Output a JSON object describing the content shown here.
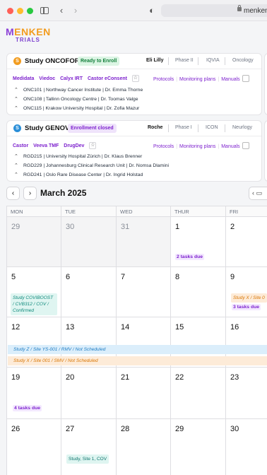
{
  "browser": {
    "url": "menkentr"
  },
  "logo": {
    "main_first": "M",
    "main_rest": "ENKEN",
    "sub": "TRIALS"
  },
  "studies": [
    {
      "initial": "S",
      "title": "Study ONCOFORM",
      "status": "Ready to Enroll",
      "sponsor": "Eli Lilly",
      "phase": "Phase II",
      "cro": "IQVIA",
      "area": "Oncology",
      "tools": [
        "Medidata",
        "Viedoc",
        "Calyx IRT",
        "Castor eConsent"
      ],
      "links": [
        "Protocols",
        "Monitoring plans",
        "Manuals"
      ],
      "sites": [
        "ONC101  |  Northway Cancer Institute  |  Dr. Emma Thorne",
        "ONC108  |  Tallinn Oncology Centre  |  Dr. Toomas Valge",
        "ONC115  |  Krakow University Hospital  |  Dr. Zofia Mazur"
      ]
    },
    {
      "initial": "S",
      "title": "Study GENOVA",
      "status": "Enrollment closed",
      "sponsor": "Roche",
      "phase": "Phase I",
      "cro": "ICON",
      "area": "Neurlogy",
      "tools": [
        "Castor",
        "Veeva TMF",
        "DrugDev"
      ],
      "links": [
        "Protocols",
        "Monitoring plans",
        "Manuals"
      ],
      "sites": [
        "RGD215  |  University Hospital Zürich  |  Dr. Klaus Brenner",
        "RGD229  |  Johannesburg Clinical Research Unit  |  Dr. Nomsa Dlamini",
        "RGD241  |  Oslo Rare Disease Center  |  Dr. Ingrid Holstad"
      ]
    }
  ],
  "calendar": {
    "month": "March 2025",
    "prev": "‹",
    "next": "›",
    "weekdays": [
      "MON",
      "TUE",
      "WED",
      "THUR",
      "FRI"
    ],
    "weeks": [
      [
        "29",
        "30",
        "31",
        "1",
        "2"
      ],
      [
        "5",
        "6",
        "7",
        "8",
        "9"
      ],
      [
        "12",
        "13",
        "14",
        "15",
        "16"
      ],
      [
        "19",
        "20",
        "21",
        "22",
        "23"
      ],
      [
        "26",
        "27",
        "28",
        "29",
        "30"
      ]
    ],
    "tasks_w1_thu": "2 tasks due",
    "tasks_w2_fri": "3 tasks due",
    "tasks_w4_mon": "4 tasks due",
    "event_w2_mon": [
      "Study COVIBOOST",
      "/ CVB312 / COV /",
      "Confirmed"
    ],
    "event_w2_fri": "Study X / Site 0",
    "band_blue": "Study Z / Site YS-001 / RMV / Not Scheduled",
    "band_orange": "Study X / Site 001 / SMV / Not Scheduled",
    "event_w5_tue": "Study, Site 1, COV"
  },
  "colors": {
    "accent_purple": "#7e22ce",
    "accent_orange": "#f29c1f",
    "status_green": "#15803d"
  }
}
